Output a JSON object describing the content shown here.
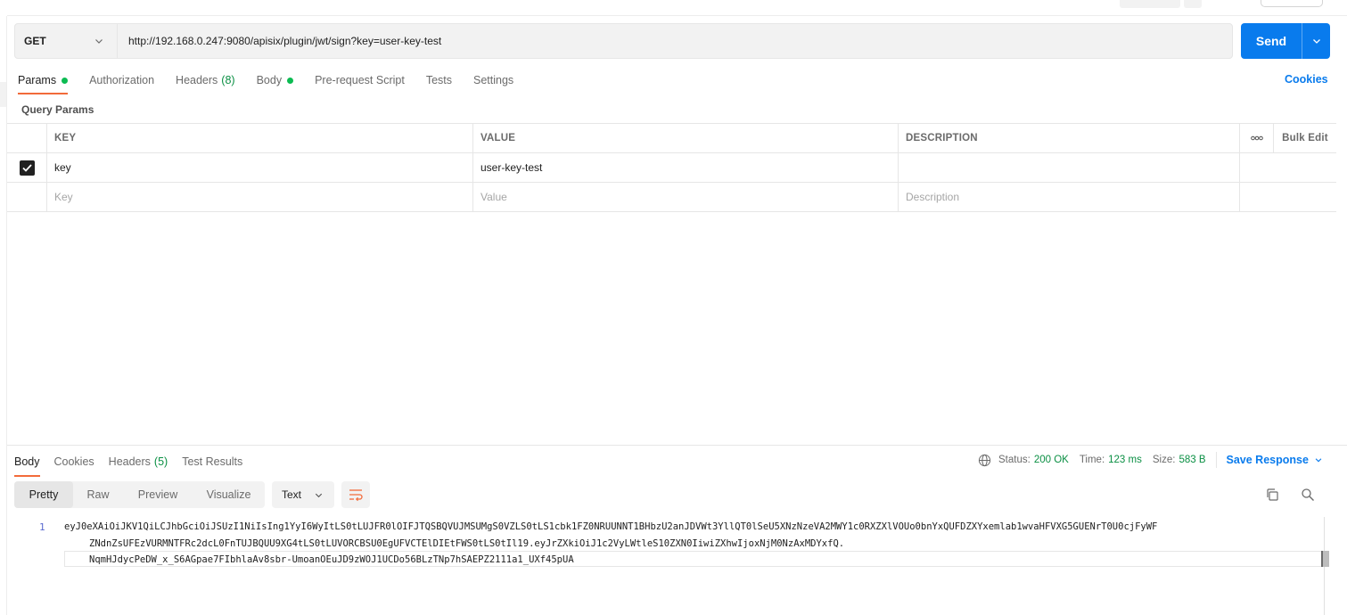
{
  "request": {
    "method": "GET",
    "url": "http://192.168.0.247:9080/apisix/plugin/jwt/sign?key=user-key-test",
    "send_label": "Send"
  },
  "tabs": {
    "params": "Params",
    "authorization": "Authorization",
    "headers": "Headers",
    "headers_count": "(8)",
    "body": "Body",
    "pre_request": "Pre-request Script",
    "tests": "Tests",
    "settings": "Settings",
    "cookies": "Cookies"
  },
  "query_params": {
    "label": "Query Params",
    "columns": {
      "key": "KEY",
      "value": "VALUE",
      "description": "DESCRIPTION",
      "more": "ooo",
      "bulk_edit": "Bulk Edit"
    },
    "rows": [
      {
        "checked": true,
        "key": "key",
        "value": "user-key-test",
        "description": ""
      }
    ],
    "placeholders": {
      "key": "Key",
      "value": "Value",
      "description": "Description"
    }
  },
  "response": {
    "tabs": {
      "body": "Body",
      "cookies": "Cookies",
      "headers": "Headers",
      "headers_count": "(5)",
      "test_results": "Test Results"
    },
    "status_label": "Status:",
    "status_value": "200 OK",
    "time_label": "Time:",
    "time_value": "123 ms",
    "size_label": "Size:",
    "size_value": "583 B",
    "save_response": "Save Response",
    "formats": {
      "pretty": "Pretty",
      "raw": "Raw",
      "preview": "Preview",
      "visualize": "Visualize"
    },
    "text_type": "Text",
    "line_number": "1",
    "body_lines": [
      "eyJ0eXAiOiJKV1QiLCJhbGciOiJSUzI1NiIsIng1YyI6WyItLS0tLUJFR0lOIFJTQSBQVUJMSUMgS0VZLS0tLS1cbk1FZ0NRUUNNT1BHbzU2anJDVWt3YllQT0lSeU5XNzNzeVA2MWY1c0RXZXlVOUo0bnYxQUFDZXYxemlab1wvaHFVXG5GUENrT0U0cjFyWF",
      "ZNdnZsUFEzVURMNTFRc2dcL0FnTUJBQUU9XG4tLS0tLUVORCBSU0EgUFVCTElDIEtFWS0tLS0tIl19.eyJrZXkiOiJ1c2VyLWtleS10ZXN0IiwiZXhwIjoxNjM0NzAxMDYxfQ.",
      "NqmHJdycPeDW_x_S6AGpae7FIbhlaAv8sbr-UmoanOEuJD9zWOJ1UCDo56BLzTNp7hSAEPZ2111a1_UXf45pUA"
    ]
  },
  "colors": {
    "accent": "#097bed",
    "active_tab_underline": "#f26b3a",
    "indicator_green": "#0cbb52",
    "status_green": "#0a8f43"
  },
  "icons": {
    "method_dropdown": "chevron-down-icon",
    "send_dropdown": "chevron-down-icon",
    "globe": "globe-icon",
    "wrap": "wrap-lines-icon",
    "copy": "copy-icon",
    "search": "search-icon"
  }
}
